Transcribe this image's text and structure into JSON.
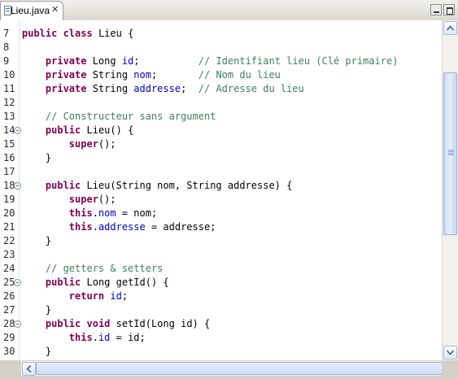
{
  "tab": {
    "label": "Lieu.java",
    "file_icon": "java-file-icon",
    "close_icon": "close-icon",
    "close_glyph": "✕"
  },
  "window_buttons": [
    "minimize-icon",
    "maximize-icon"
  ],
  "colors": {
    "keyword": "#7f0055",
    "field": "#0000c0",
    "comment": "#3f7f5f",
    "text": "#000000"
  },
  "editor": {
    "lines": [
      {
        "n": "7",
        "fold": false,
        "tokens": [
          [
            "kw",
            "public"
          ],
          [
            "t",
            " "
          ],
          [
            "kw",
            "class"
          ],
          [
            "t",
            " Lieu {"
          ]
        ]
      },
      {
        "n": "8",
        "fold": false,
        "tokens": []
      },
      {
        "n": "9",
        "fold": false,
        "tokens": [
          [
            "t",
            "    "
          ],
          [
            "kw",
            "private"
          ],
          [
            "t",
            " Long "
          ],
          [
            "fld",
            "id"
          ],
          [
            "t",
            ";          "
          ],
          [
            "cmt",
            "// Identifiant lieu (Clé primaire)"
          ]
        ]
      },
      {
        "n": "10",
        "fold": false,
        "tokens": [
          [
            "t",
            "    "
          ],
          [
            "kw",
            "private"
          ],
          [
            "t",
            " String "
          ],
          [
            "fld",
            "nom"
          ],
          [
            "t",
            ";       "
          ],
          [
            "cmt",
            "// Nom du lieu"
          ]
        ]
      },
      {
        "n": "11",
        "fold": false,
        "tokens": [
          [
            "t",
            "    "
          ],
          [
            "kw",
            "private"
          ],
          [
            "t",
            " String "
          ],
          [
            "fld",
            "addresse"
          ],
          [
            "t",
            ";  "
          ],
          [
            "cmt",
            "// Adresse du lieu"
          ]
        ]
      },
      {
        "n": "12",
        "fold": false,
        "tokens": []
      },
      {
        "n": "13",
        "fold": false,
        "tokens": [
          [
            "t",
            "    "
          ],
          [
            "cmt",
            "// Constructeur sans argument"
          ]
        ]
      },
      {
        "n": "14",
        "fold": true,
        "tokens": [
          [
            "t",
            "    "
          ],
          [
            "kw",
            "public"
          ],
          [
            "t",
            " Lieu() {"
          ]
        ]
      },
      {
        "n": "15",
        "fold": false,
        "tokens": [
          [
            "t",
            "        "
          ],
          [
            "kw",
            "super"
          ],
          [
            "t",
            "();"
          ]
        ]
      },
      {
        "n": "16",
        "fold": false,
        "tokens": [
          [
            "t",
            "    }"
          ]
        ]
      },
      {
        "n": "17",
        "fold": false,
        "tokens": []
      },
      {
        "n": "18",
        "fold": true,
        "tokens": [
          [
            "t",
            "    "
          ],
          [
            "kw",
            "public"
          ],
          [
            "t",
            " Lieu(String nom, String addresse) {"
          ]
        ]
      },
      {
        "n": "19",
        "fold": false,
        "tokens": [
          [
            "t",
            "        "
          ],
          [
            "kw",
            "super"
          ],
          [
            "t",
            "();"
          ]
        ]
      },
      {
        "n": "20",
        "fold": false,
        "tokens": [
          [
            "t",
            "        "
          ],
          [
            "kw",
            "this"
          ],
          [
            "t",
            "."
          ],
          [
            "fld",
            "nom"
          ],
          [
            "t",
            " = nom;"
          ]
        ]
      },
      {
        "n": "21",
        "fold": false,
        "tokens": [
          [
            "t",
            "        "
          ],
          [
            "kw",
            "this"
          ],
          [
            "t",
            "."
          ],
          [
            "fld",
            "addresse"
          ],
          [
            "t",
            " = addresse;"
          ]
        ]
      },
      {
        "n": "22",
        "fold": false,
        "tokens": [
          [
            "t",
            "    }"
          ]
        ]
      },
      {
        "n": "23",
        "fold": false,
        "tokens": []
      },
      {
        "n": "24",
        "fold": false,
        "tokens": [
          [
            "t",
            "    "
          ],
          [
            "cmt",
            "// getters & setters"
          ]
        ]
      },
      {
        "n": "25",
        "fold": true,
        "tokens": [
          [
            "t",
            "    "
          ],
          [
            "kw",
            "public"
          ],
          [
            "t",
            " Long getId() {"
          ]
        ]
      },
      {
        "n": "26",
        "fold": false,
        "tokens": [
          [
            "t",
            "        "
          ],
          [
            "kw",
            "return"
          ],
          [
            "t",
            " "
          ],
          [
            "fld",
            "id"
          ],
          [
            "t",
            ";"
          ]
        ]
      },
      {
        "n": "27",
        "fold": false,
        "tokens": [
          [
            "t",
            "    }"
          ]
        ]
      },
      {
        "n": "28",
        "fold": true,
        "tokens": [
          [
            "t",
            "    "
          ],
          [
            "kw",
            "public"
          ],
          [
            "t",
            " "
          ],
          [
            "kw",
            "void"
          ],
          [
            "t",
            " setId(Long id) {"
          ]
        ]
      },
      {
        "n": "29",
        "fold": false,
        "tokens": [
          [
            "t",
            "        "
          ],
          [
            "kw",
            "this"
          ],
          [
            "t",
            "."
          ],
          [
            "fld",
            "id"
          ],
          [
            "t",
            " = id;"
          ]
        ]
      },
      {
        "n": "30",
        "fold": false,
        "tokens": [
          [
            "t",
            "    }"
          ]
        ]
      }
    ]
  },
  "scrollbars": {
    "vertical": {
      "up_icon": "arrow-up-icon",
      "down_icon": "arrow-down-icon"
    },
    "horizontal": {
      "left_icon": "arrow-left-icon",
      "right_icon": "arrow-right-icon"
    }
  }
}
